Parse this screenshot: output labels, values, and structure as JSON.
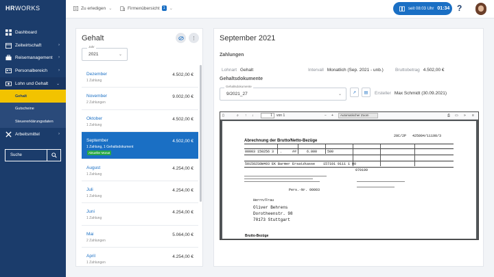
{
  "brand": {
    "bold": "HR",
    "rest": "WORKS"
  },
  "sidebar": {
    "items": [
      {
        "label": "Dashboard"
      },
      {
        "label": "Zeitwirtschaft"
      },
      {
        "label": "Reisemanagement"
      },
      {
        "label": "Personalbereich"
      },
      {
        "label": "Lohn und Gehalt"
      },
      {
        "label": "Arbeitsmittel"
      }
    ],
    "subitems": [
      {
        "label": "Gehalt"
      },
      {
        "label": "Gutscheine"
      },
      {
        "label": "Steuererklärungsdaten"
      }
    ],
    "search_label": "Suche"
  },
  "topbar": {
    "todo_label": "Zu erledigen",
    "company_label": "Firmenübersicht",
    "company_badge": "1",
    "timer_label": "seit 08:03 Uhr",
    "timer_time": "01:34",
    "help": "?"
  },
  "left": {
    "title": "Gehalt",
    "year_label": "Jahr",
    "year_value": "2021",
    "months": [
      {
        "name": "Dezember",
        "sub": "1 Zahlung",
        "amount": "4.502,00 €"
      },
      {
        "name": "November",
        "sub": "2 Zahlungen",
        "amount": "9.002,00 €"
      },
      {
        "name": "Oktober",
        "sub": "1 Zahlung",
        "amount": "4.502,00 €"
      },
      {
        "name": "September",
        "sub": "1 Zahlung, 1 Gehaltsdokument",
        "amount": "4.502,00 €",
        "tag": "Aktueller Monat"
      },
      {
        "name": "August",
        "sub": "1 Zahlung",
        "amount": "4.254,00 €"
      },
      {
        "name": "Juli",
        "sub": "1 Zahlung",
        "amount": "4.254,00 €"
      },
      {
        "name": "Juni",
        "sub": "1 Zahlung",
        "amount": "4.254,00 €"
      },
      {
        "name": "Mai",
        "sub": "2 Zahlungen",
        "amount": "5.064,00 €"
      },
      {
        "name": "April",
        "sub": "1 Zahlungen",
        "amount": "4.254,00 €"
      }
    ]
  },
  "right": {
    "title": "September 2021",
    "payments_heading": "Zahlungen",
    "wage_type_label": "Lohnart",
    "wage_type_value": "Gehalt",
    "interval_label": "Intervall",
    "interval_value": "Monatlich (Sep. 2021 - unb.)",
    "gross_label": "Bruttobetrag",
    "gross_value": "4.502,00 €",
    "docs_heading": "Gehaltsdokumente",
    "doc_select_label": "Gehaltsdokumente",
    "doc_select_value": "9/2021_27",
    "creator_label": "Ersteller",
    "creator_value": "Max Schmidt (30.09.2021)"
  },
  "viewer": {
    "page": "1",
    "page_of": "von 1",
    "zoom": "Automatischer Zoom",
    "doc": {
      "heading": "Abrechnung der Brutto/Netto-Bezüge",
      "code": "20C/2P   425094/11190/3",
      "row1": "00003 150256 3   .     ##     6.000     500",
      "row2": "501502S0W493 EK Barmer Ersatzkasse    157101 9111 1 00",
      "row3": "070199",
      "row4": "Pers.-Nr. 00003",
      "salutation": "Herrn/Frau",
      "name": "Oliver Behrens",
      "street": "Dorotheenstr. 98",
      "city": "70173 Stuttgart",
      "footer": "Brutto-Bezüge"
    }
  }
}
